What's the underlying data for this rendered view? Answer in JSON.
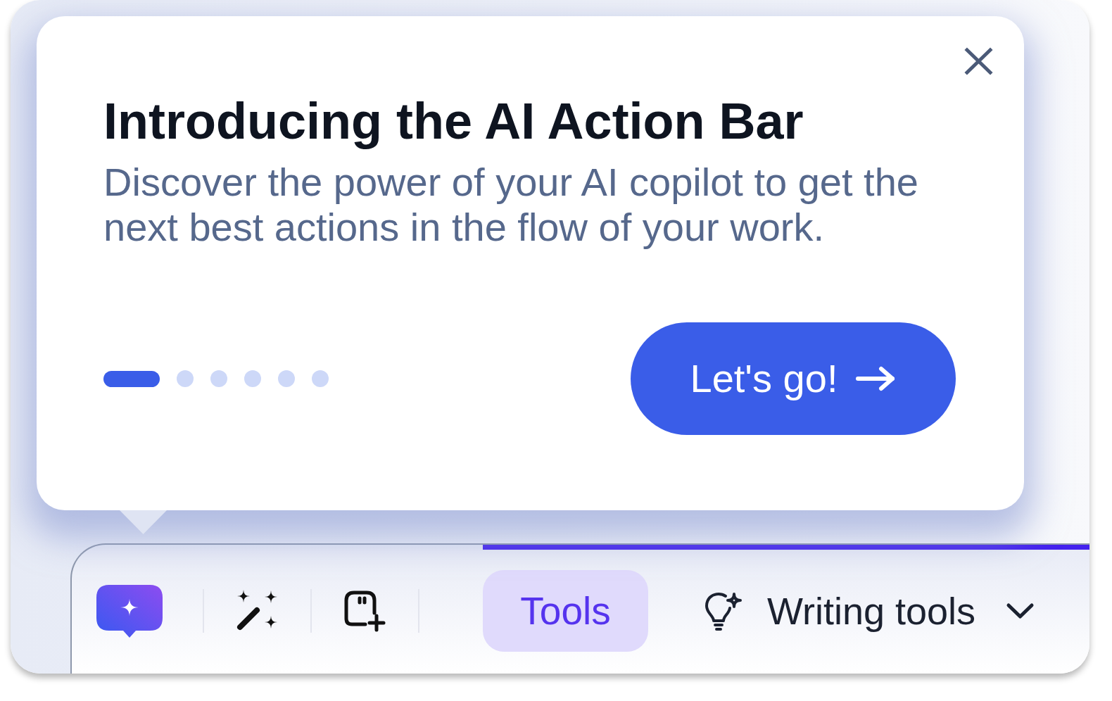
{
  "popover": {
    "title": "Introducing the AI Action Bar",
    "description": "Discover the power of your AI copilot to get the next best actions in the flow of your work.",
    "pager": [
      {
        "selected": true
      },
      {
        "selected": false
      },
      {
        "selected": false
      },
      {
        "selected": false
      },
      {
        "selected": false
      },
      {
        "selected": false
      }
    ],
    "primary_button": {
      "label": "Let's go!"
    }
  },
  "toolbar": {
    "tabs": [
      {
        "label": "Tools",
        "selected": true,
        "kind": "tab"
      },
      {
        "label": "Writing tools",
        "selected": false,
        "kind": "dropdown"
      }
    ]
  }
}
